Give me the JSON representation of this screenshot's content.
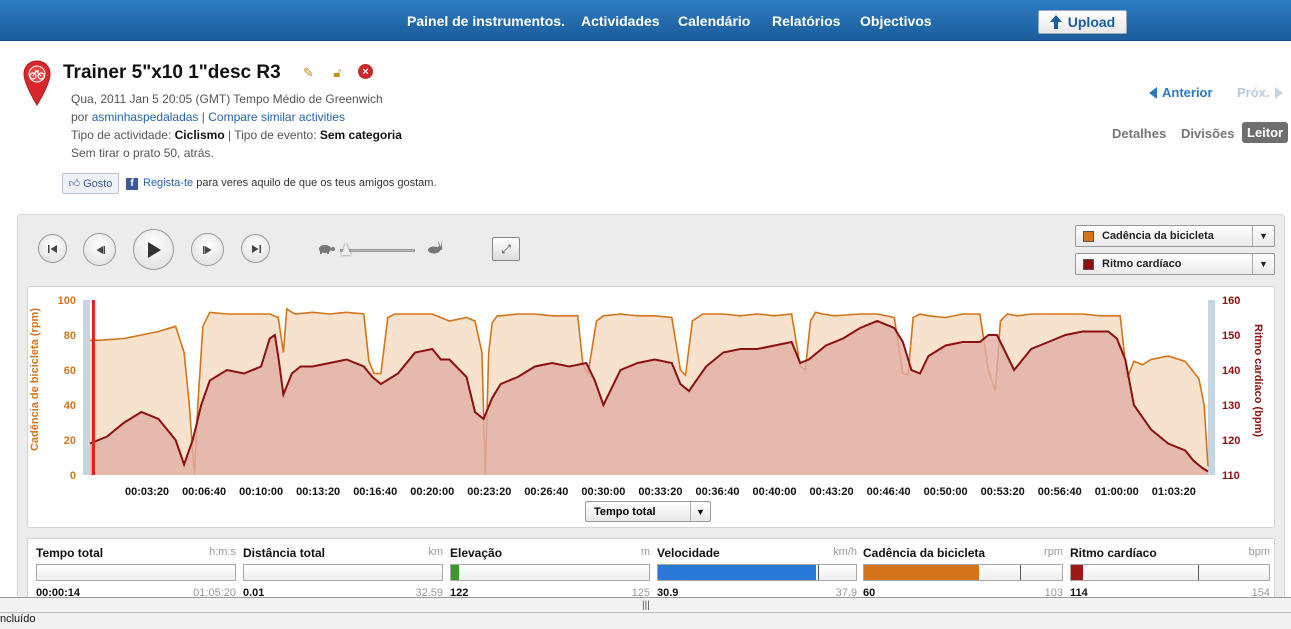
{
  "nav": {
    "items": [
      "Painel de instrumentos.",
      "Actividades",
      "Calendário",
      "Relatórios",
      "Objectivos"
    ],
    "upload_label": "Upload"
  },
  "activity": {
    "title": "Trainer 5\"x10 1\"desc R3",
    "datetime": "Qua, 2011 Jan 5 20:05 (GMT) Tempo Médio de Greenwich",
    "by_prefix": "por",
    "user": "asminhaspedaladas",
    "sep": "|",
    "compare_link": "Compare similar activities",
    "type_label": "Tipo de actividade:",
    "type_value": "Ciclismo",
    "event_label": "Tipo de evento:",
    "event_value": "Sem categoria",
    "description": "Sem tirar o prato 50, atrás."
  },
  "social": {
    "like_label": "Gosto",
    "fb_link": "Regista-te",
    "fb_text": "para veres aquilo de que os teus amigos gostam."
  },
  "pager": {
    "prev": "Anterior",
    "next": "Próx."
  },
  "view_tabs": [
    {
      "label": "Detalhes",
      "active": false
    },
    {
      "label": "Divisões",
      "active": false
    },
    {
      "label": "Leitor",
      "active": true
    }
  ],
  "series_selects": [
    {
      "label": "Cadência da bicicleta",
      "color": "#d4741a"
    },
    {
      "label": "Ritmo cardíaco",
      "color": "#8c1010"
    }
  ],
  "x_axis_select": "Tempo total",
  "chart_data": {
    "type": "area",
    "ylabel_left": "Cadência de bicicleta (rpm)",
    "ylabel_right": "Ritmo cardíaco (bpm)",
    "ylim_left": [
      0,
      100
    ],
    "ylim_right": [
      110,
      160
    ],
    "yticks_left": [
      "100",
      "80",
      "60",
      "40",
      "20",
      "0"
    ],
    "yticks_right": [
      "160",
      "150",
      "140",
      "130",
      "120",
      "110"
    ],
    "xtick_labels": [
      "00:03:20",
      "00:06:40",
      "00:10:00",
      "00:13:20",
      "00:16:40",
      "00:20:00",
      "00:23:20",
      "00:26:40",
      "00:30:00",
      "00:33:20",
      "00:36:40",
      "00:40:00",
      "00:43:20",
      "00:46:40",
      "00:50:00",
      "00:53:20",
      "00:56:40",
      "01:00:00",
      "01:03:20"
    ],
    "x_minutes_range": [
      0,
      65.33
    ],
    "series": [
      {
        "name": "Cadência da bicicleta",
        "axis": "left",
        "color": "#d4741a",
        "fill": "#f6ddc6",
        "x_minutes": [
          0,
          0.5,
          2,
          3,
          4,
          5,
          5.5,
          5.8,
          6.1,
          6.3,
          6.6,
          7,
          8,
          9,
          10.5,
          11,
          11.3,
          11.5,
          11.8,
          12,
          13,
          14,
          15,
          16,
          16.3,
          16.6,
          17,
          17.4,
          17.8,
          18.3,
          19,
          20,
          21,
          22,
          22.5,
          22.9,
          23.1,
          23.3,
          23.5,
          23.8,
          24,
          25,
          26,
          27,
          28,
          28.5,
          28.8,
          29.1,
          29.6,
          30,
          31,
          32,
          33,
          34,
          34.5,
          34.8,
          35.2,
          35.8,
          36.5,
          37,
          38,
          39,
          40,
          41,
          41.5,
          41.8,
          42.1,
          42.4,
          42.8,
          43.5,
          45,
          46,
          47,
          47.5,
          47.8,
          48.1,
          48.5,
          49,
          50,
          51,
          52,
          52.5,
          52.9,
          53.2,
          53.6,
          54.2,
          55,
          56,
          57,
          58,
          59,
          60.2,
          60.6,
          61,
          61.5,
          62,
          63,
          64,
          64.8,
          65.1,
          65.33
        ],
        "values": [
          77,
          77,
          78,
          80,
          82,
          85,
          70,
          40,
          0,
          40,
          85,
          93,
          92,
          92,
          92,
          90,
          70,
          95,
          93,
          92,
          93,
          92,
          93,
          92,
          65,
          58,
          58,
          90,
          92,
          92,
          92,
          92,
          88,
          90,
          88,
          70,
          0,
          70,
          87,
          91,
          91,
          92,
          92,
          91,
          91,
          91,
          63,
          58,
          88,
          91,
          92,
          91,
          91,
          90,
          60,
          57,
          88,
          92,
          92,
          92,
          91,
          92,
          91,
          92,
          62,
          60,
          88,
          93,
          92,
          91,
          92,
          92,
          90,
          58,
          57,
          90,
          92,
          91,
          90,
          92,
          92,
          60,
          48,
          88,
          92,
          91,
          92,
          92,
          92,
          92,
          91,
          91,
          55,
          65,
          63,
          66,
          68,
          65,
          55,
          40,
          5
        ]
      },
      {
        "name": "Ritmo cardíaco",
        "axis": "right",
        "color": "#8c1010",
        "fill": "#e1afa5",
        "x_minutes": [
          0,
          1,
          2,
          3,
          4,
          5,
          5.5,
          6,
          6.5,
          7,
          8,
          9,
          10,
          10.5,
          10.8,
          11,
          11.3,
          11.8,
          12.3,
          13,
          14,
          15,
          16,
          16.5,
          17,
          18,
          19,
          20,
          20.5,
          21,
          22,
          22.5,
          23,
          23.5,
          24,
          25,
          26,
          27,
          28,
          29,
          29.5,
          30,
          31,
          32,
          33,
          34,
          34.5,
          35,
          36,
          37,
          38,
          39,
          40,
          41,
          41.5,
          42,
          43,
          44,
          45,
          46,
          47,
          47.5,
          48,
          48.5,
          49,
          50,
          51,
          52,
          52.5,
          53,
          54,
          55,
          56,
          57,
          58,
          59,
          59.5,
          60,
          60.5,
          61,
          62,
          63,
          64,
          64.5,
          65,
          65.33
        ],
        "values": [
          119,
          121,
          125,
          128,
          126,
          120,
          113,
          120,
          130,
          137,
          140,
          139,
          141,
          149,
          150,
          144,
          133,
          139,
          141,
          141,
          142,
          143,
          141,
          138,
          136,
          139,
          145,
          146,
          143,
          143,
          138,
          128,
          126,
          132,
          136,
          138,
          141,
          142,
          141,
          142,
          137,
          130,
          140,
          142,
          143,
          142,
          136,
          134,
          141,
          145,
          146,
          146,
          147,
          148,
          142,
          143,
          147,
          149,
          152,
          154,
          152,
          148,
          140,
          139,
          144,
          147,
          148,
          148,
          150,
          150,
          140,
          146,
          148,
          150,
          151,
          151,
          151,
          149,
          143,
          130,
          123,
          119,
          117,
          114,
          112,
          111,
          111
        ]
      }
    ],
    "cursor_position_minutes": 0.2
  },
  "stats": [
    {
      "name": "Tempo total",
      "unit": "h:m:s",
      "value": "00:00:14",
      "max": "01:05:20",
      "fraction": 0.0,
      "color": "#888888",
      "marker": null
    },
    {
      "name": "Distância total",
      "unit": "km",
      "value": "0.01",
      "max": "32.59",
      "fraction": 0.0,
      "color": "#888888",
      "marker": null
    },
    {
      "name": "Elevação",
      "unit": "m",
      "value": "122",
      "max": "125",
      "fraction": 0.04,
      "color": "#3b9a2a",
      "marker": null
    },
    {
      "name": "Velocidade",
      "unit": "km/h",
      "value": "30.9",
      "max": "37.9",
      "fraction": 0.8,
      "color": "#2a78d8",
      "marker": 0.81
    },
    {
      "name": "Cadência da bicicleta",
      "unit": "rpm",
      "value": "60",
      "max": "103",
      "fraction": 0.58,
      "color": "#d4741a",
      "marker": 0.79
    },
    {
      "name": "Ritmo cardíaco",
      "unit": "bpm",
      "value": "114",
      "max": "154",
      "fraction": 0.06,
      "color": "#a01818",
      "marker": 0.64
    }
  ],
  "status_text": "ncluído",
  "splitter_glyph": "|||"
}
